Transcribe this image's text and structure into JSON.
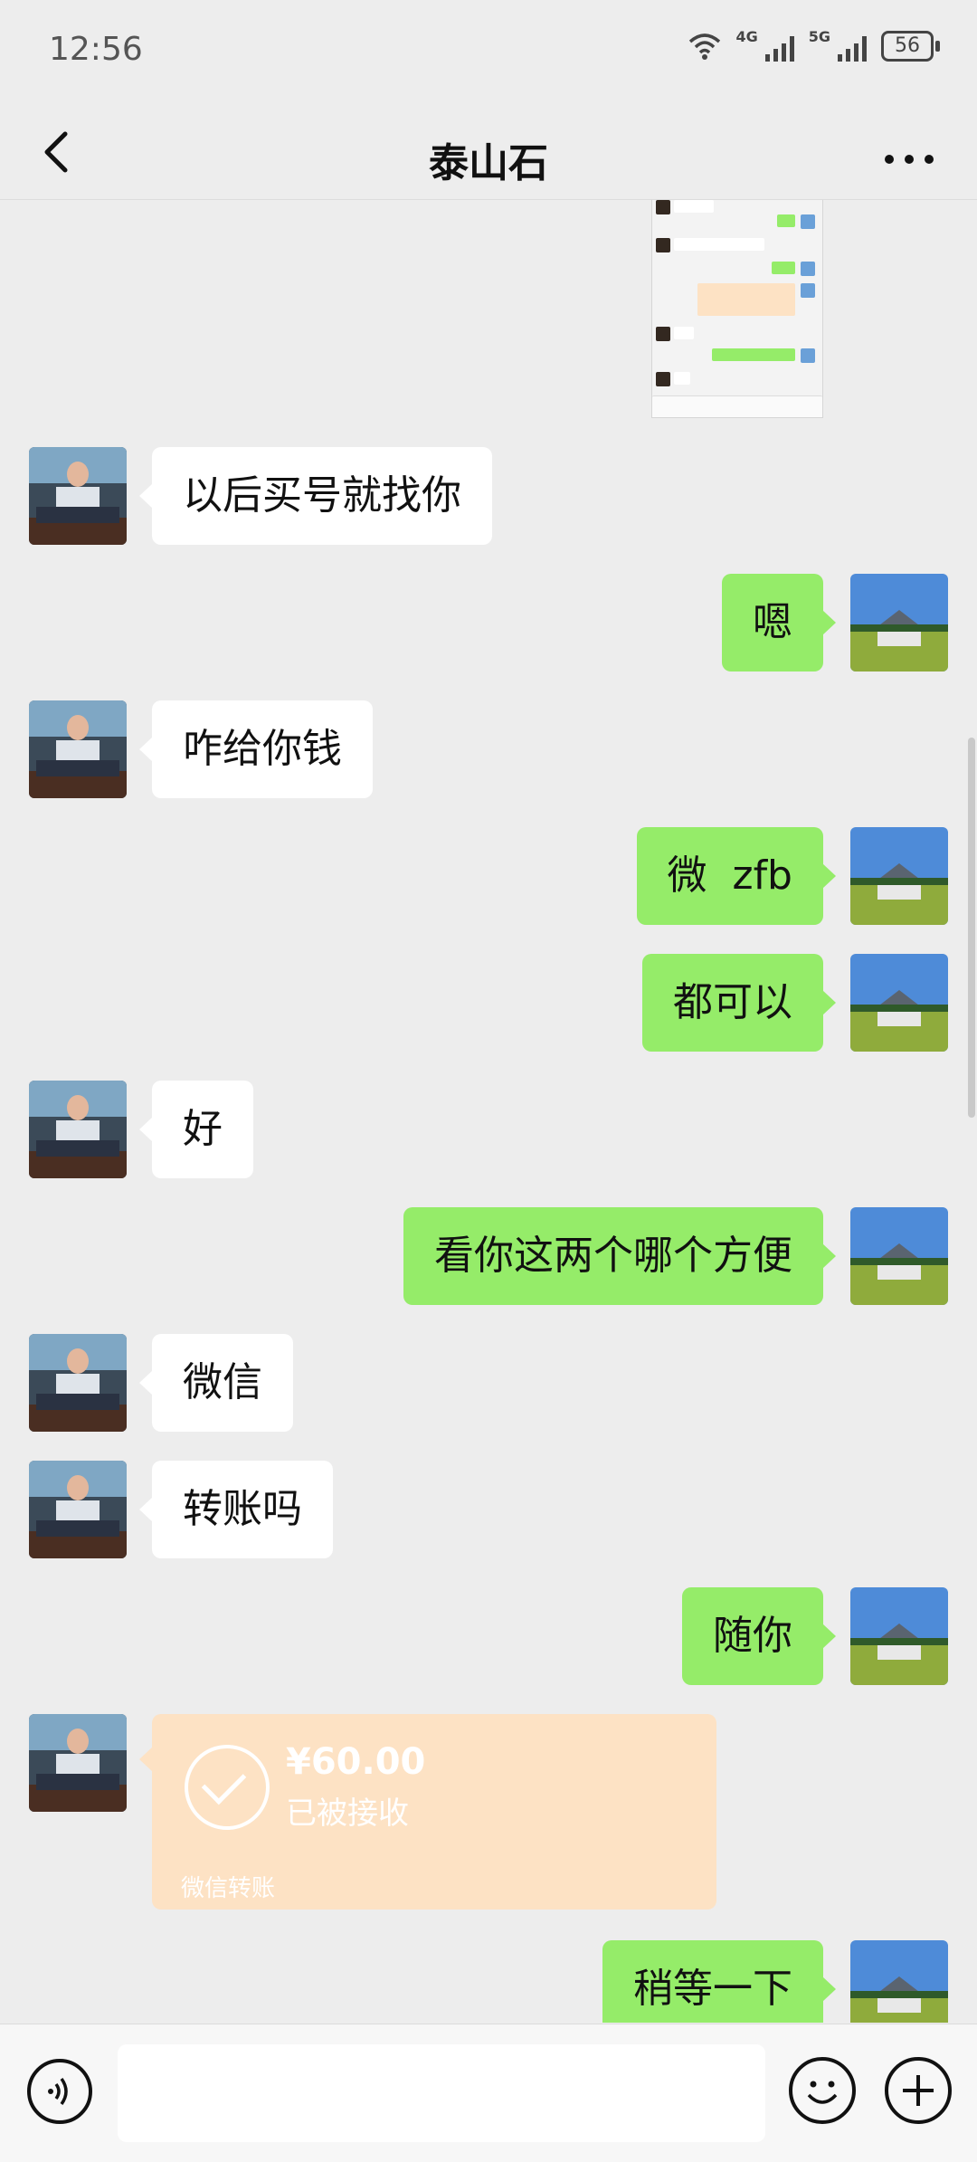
{
  "status_bar": {
    "time": "12:56",
    "net1": "4G",
    "net2": "5G",
    "battery": "56"
  },
  "header": {
    "title": "泰山石"
  },
  "messages": [
    {
      "side": "left",
      "text": "以后买号就找你"
    },
    {
      "side": "right",
      "text": "嗯"
    },
    {
      "side": "left",
      "text": "咋给你钱"
    },
    {
      "side": "right",
      "text": "微  zfb"
    },
    {
      "side": "right",
      "text": "都可以"
    },
    {
      "side": "left",
      "text": "好"
    },
    {
      "side": "right",
      "text": "看你这两个哪个方便"
    },
    {
      "side": "left",
      "text": "微信"
    },
    {
      "side": "left",
      "text": "转账吗"
    },
    {
      "side": "right",
      "text": "随你"
    },
    {
      "side": "right",
      "text": "稍等一下"
    }
  ],
  "transfer": {
    "amount": "¥60.00",
    "status": "已被接收",
    "label": "微信转账"
  },
  "input_bar": {
    "placeholder": ""
  },
  "colors": {
    "background": "#ededed",
    "sent_bubble": "#95ec69",
    "received_bubble": "#ffffff",
    "transfer_card": "#fde2c4"
  },
  "icons": {
    "back": "back-arrow-icon",
    "more": "more-dots-icon",
    "voice": "voice-icon",
    "emoji": "emoji-icon",
    "plus": "plus-icon"
  }
}
